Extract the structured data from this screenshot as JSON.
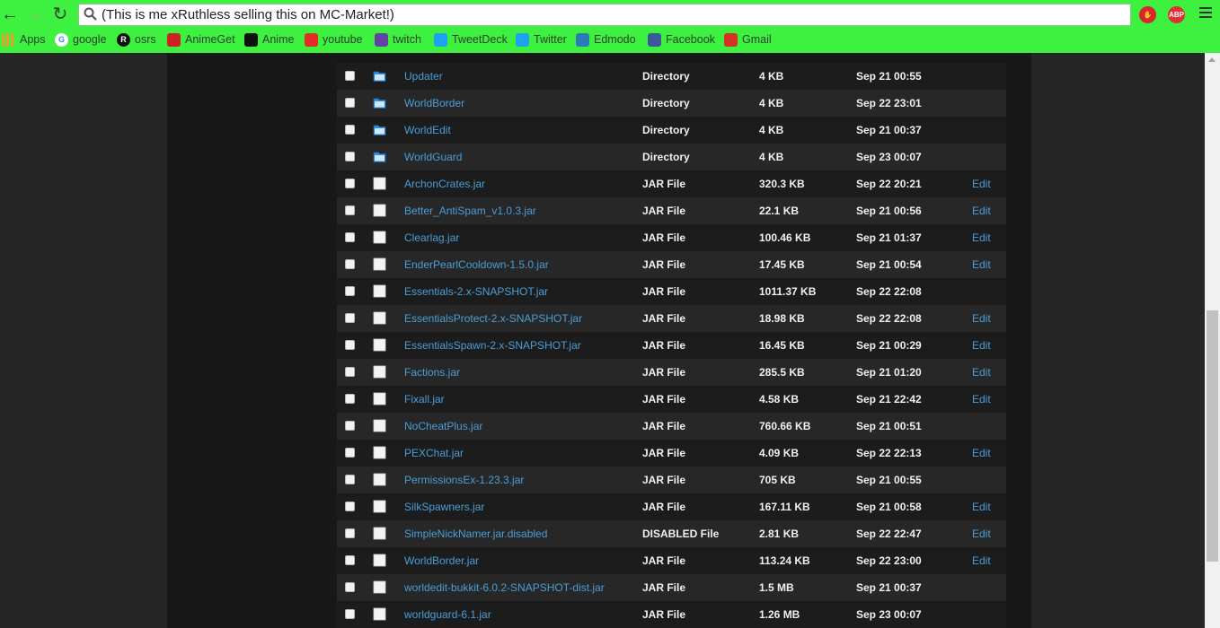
{
  "browser": {
    "url_text": "(This is me xRuthless selling this on MC-Market!)",
    "back_icon": "back-arrow-icon",
    "forward_icon": "forward-arrow-icon",
    "reload_icon": "reload-icon",
    "ext_abp_label": "ABP"
  },
  "bookmarks": [
    {
      "label": "Apps",
      "icon": "apps-grid-icon",
      "color": "#e8a02a"
    },
    {
      "label": "google",
      "icon": "google-icon",
      "color": "#ffffff"
    },
    {
      "label": "osrs",
      "icon": "osrs-icon",
      "color": "#111111"
    },
    {
      "label": "AnimeGet",
      "icon": "animeget-icon",
      "color": "#cc2222"
    },
    {
      "label": "Anime",
      "icon": "anime-icon",
      "color": "#111111"
    },
    {
      "label": "youtube",
      "icon": "youtube-icon",
      "color": "#e52d27"
    },
    {
      "label": "twitch",
      "icon": "twitch-icon",
      "color": "#6441a5"
    },
    {
      "label": "TweetDeck",
      "icon": "tweetdeck-icon",
      "color": "#1da1f2"
    },
    {
      "label": "Twitter",
      "icon": "twitter-icon",
      "color": "#1da1f2"
    },
    {
      "label": "Edmodo",
      "icon": "edmodo-icon",
      "color": "#2b7bb9"
    },
    {
      "label": "Facebook",
      "icon": "facebook-icon",
      "color": "#3b5998"
    },
    {
      "label": "Gmail",
      "icon": "gmail-icon",
      "color": "#d93025"
    }
  ],
  "files": [
    {
      "name": "Updater",
      "type": "Directory",
      "size": "4 KB",
      "date": "Sep 21 00:55",
      "edit": "",
      "kind": "folder"
    },
    {
      "name": "WorldBorder",
      "type": "Directory",
      "size": "4 KB",
      "date": "Sep 22 23:01",
      "edit": "",
      "kind": "folder"
    },
    {
      "name": "WorldEdit",
      "type": "Directory",
      "size": "4 KB",
      "date": "Sep 21 00:37",
      "edit": "",
      "kind": "folder"
    },
    {
      "name": "WorldGuard",
      "type": "Directory",
      "size": "4 KB",
      "date": "Sep 23 00:07",
      "edit": "",
      "kind": "folder"
    },
    {
      "name": "ArchonCrates.jar",
      "type": "JAR File",
      "size": "320.3 KB",
      "date": "Sep 22 20:21",
      "edit": "Edit",
      "kind": "file"
    },
    {
      "name": "Better_AntiSpam_v1.0.3.jar",
      "type": "JAR File",
      "size": "22.1 KB",
      "date": "Sep 21 00:56",
      "edit": "Edit",
      "kind": "file"
    },
    {
      "name": "Clearlag.jar",
      "type": "JAR File",
      "size": "100.46 KB",
      "date": "Sep 21 01:37",
      "edit": "Edit",
      "kind": "file"
    },
    {
      "name": "EnderPearlCooldown-1.5.0.jar",
      "type": "JAR File",
      "size": "17.45 KB",
      "date": "Sep 21 00:54",
      "edit": "Edit",
      "kind": "file"
    },
    {
      "name": "Essentials-2.x-SNAPSHOT.jar",
      "type": "JAR File",
      "size": "1011.37 KB",
      "date": "Sep 22 22:08",
      "edit": "",
      "kind": "file"
    },
    {
      "name": "EssentialsProtect-2.x-SNAPSHOT.jar",
      "type": "JAR File",
      "size": "18.98 KB",
      "date": "Sep 22 22:08",
      "edit": "Edit",
      "kind": "file"
    },
    {
      "name": "EssentialsSpawn-2.x-SNAPSHOT.jar",
      "type": "JAR File",
      "size": "16.45 KB",
      "date": "Sep 21 00:29",
      "edit": "Edit",
      "kind": "file"
    },
    {
      "name": "Factions.jar",
      "type": "JAR File",
      "size": "285.5 KB",
      "date": "Sep 21 01:20",
      "edit": "Edit",
      "kind": "file"
    },
    {
      "name": "Fixall.jar",
      "type": "JAR File",
      "size": "4.58 KB",
      "date": "Sep 21 22:42",
      "edit": "Edit",
      "kind": "file"
    },
    {
      "name": "NoCheatPlus.jar",
      "type": "JAR File",
      "size": "760.66 KB",
      "date": "Sep 21 00:51",
      "edit": "",
      "kind": "file"
    },
    {
      "name": "PEXChat.jar",
      "type": "JAR File",
      "size": "4.09 KB",
      "date": "Sep 22 22:13",
      "edit": "Edit",
      "kind": "file"
    },
    {
      "name": "PermissionsEx-1.23.3.jar",
      "type": "JAR File",
      "size": "705 KB",
      "date": "Sep 21 00:55",
      "edit": "",
      "kind": "file"
    },
    {
      "name": "SilkSpawners.jar",
      "type": "JAR File",
      "size": "167.11 KB",
      "date": "Sep 21 00:58",
      "edit": "Edit",
      "kind": "file"
    },
    {
      "name": "SimpleNickNamer.jar.disabled",
      "type": "DISABLED File",
      "size": "2.81 KB",
      "date": "Sep 22 22:47",
      "edit": "Edit",
      "kind": "file"
    },
    {
      "name": "WorldBorder.jar",
      "type": "JAR File",
      "size": "113.24 KB",
      "date": "Sep 22 23:00",
      "edit": "Edit",
      "kind": "file"
    },
    {
      "name": "worldedit-bukkit-6.0.2-SNAPSHOT-dist.jar",
      "type": "JAR File",
      "size": "1.5 MB",
      "date": "Sep 21 00:37",
      "edit": "",
      "kind": "file"
    },
    {
      "name": "worldguard-6.1.jar",
      "type": "JAR File",
      "size": "1.26 MB",
      "date": "Sep 23 00:07",
      "edit": "",
      "kind": "file"
    }
  ]
}
